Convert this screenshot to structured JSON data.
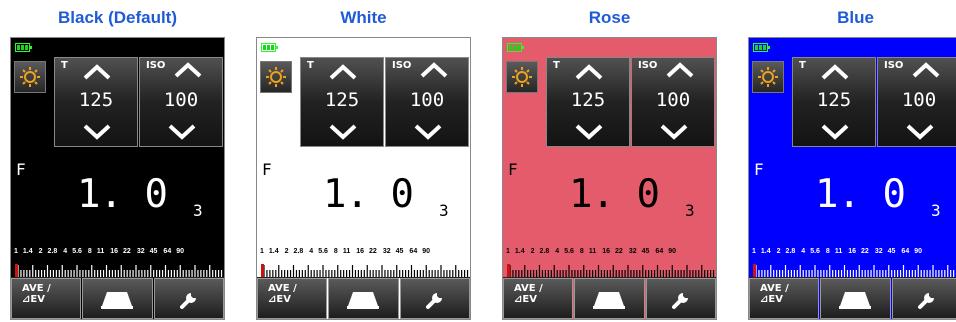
{
  "variants": [
    {
      "title": "Black (Default)",
      "title_color": "#1f5bd6",
      "bg": "#000000",
      "fg": "#ffffff"
    },
    {
      "title": "White",
      "title_color": "#1f5bd6",
      "bg": "#ffffff",
      "fg": "#000000"
    },
    {
      "title": "Rose",
      "title_color": "#1f5bd6",
      "bg": "#e45c6c",
      "fg": "#000000"
    },
    {
      "title": "Blue",
      "title_color": "#1f5bd6",
      "bg": "#0000ff",
      "fg": "#ffffff"
    }
  ],
  "meter": {
    "shutter_label": "T",
    "shutter_value": "125",
    "iso_label": "ISO",
    "iso_value": "100",
    "f_label": "F",
    "f_value": "1. 0",
    "f_sub": "3",
    "scale_labels": [
      "1",
      "1.4",
      "2",
      "2.8",
      "4",
      "5.6",
      "8",
      "11",
      "16",
      "22",
      "32",
      "45",
      "64",
      "90"
    ],
    "ave_line1": "AVE /",
    "ave_line2": "⊿EV"
  },
  "icons": {
    "battery": "battery-full-icon",
    "mode": "sun-icon",
    "up": "chevron-up-icon",
    "down": "chevron-down-icon",
    "flash": "flash-head-icon",
    "settings": "wrench-icon"
  },
  "colors": {
    "battery": "#1fd41f",
    "marker": "#cc1111",
    "sun": "#f0a21a"
  }
}
